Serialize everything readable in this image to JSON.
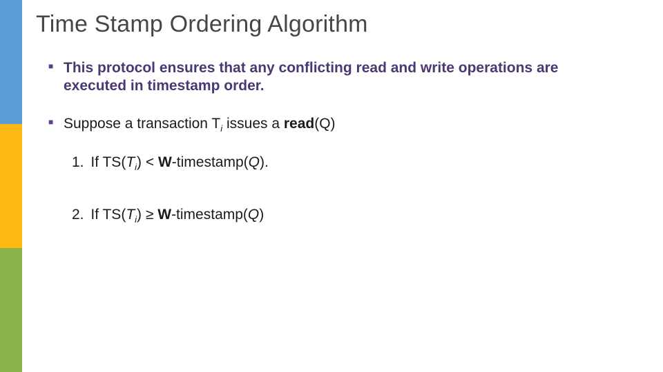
{
  "title": "Time Stamp Ordering Algorithm",
  "bullet1": "This protocol ensures that any conflicting read and write operations are executed in timestamp order.",
  "bullet2": {
    "pre": "Suppose a transaction T",
    "sub": "i",
    "mid": " issues a ",
    "bold": "read",
    "post": "(Q)"
  },
  "item1": {
    "num": "1.",
    "a": "If TS(",
    "t": "T",
    "i": "i",
    "b": ") < ",
    "w": "W",
    "c": "-timestamp(",
    "q": "Q",
    "d": ")."
  },
  "item2": {
    "num": "2.",
    "a": "If TS(",
    "t": "T",
    "i": "i",
    "b": ") ",
    "ge": "≥",
    "sp": " ",
    "w": "W",
    "c": "-timestamp(",
    "q": "Q",
    "d": ")"
  }
}
